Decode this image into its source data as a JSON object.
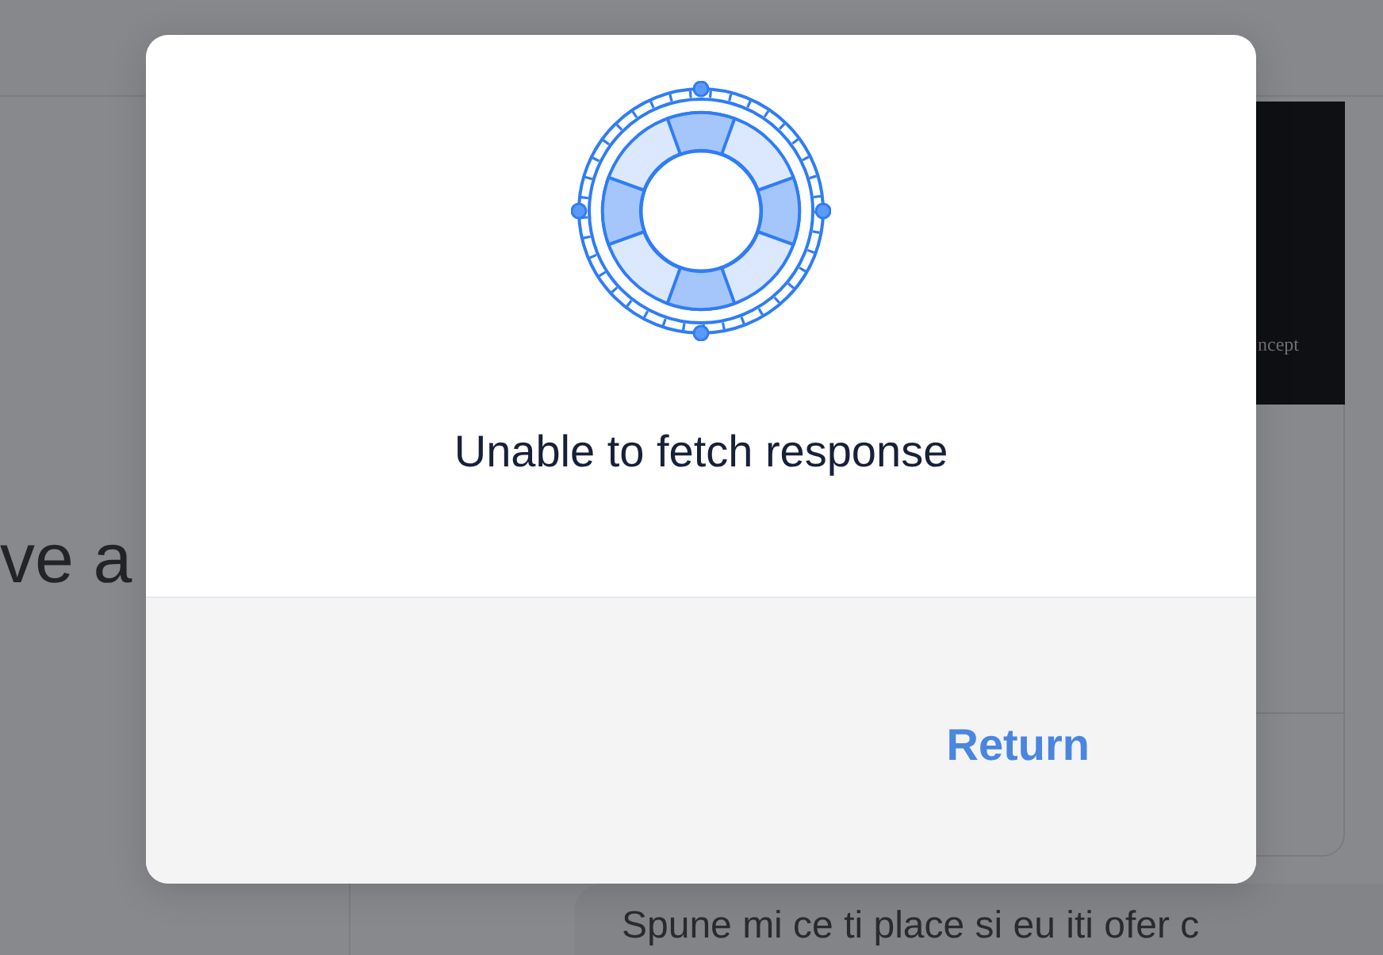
{
  "background": {
    "heading_fragment": "ve a",
    "banner_caption": "ncept",
    "message": "Spune mi ce ti place si eu iti ofer c"
  },
  "dialog": {
    "message": "Unable to fetch response",
    "button": "Return"
  }
}
